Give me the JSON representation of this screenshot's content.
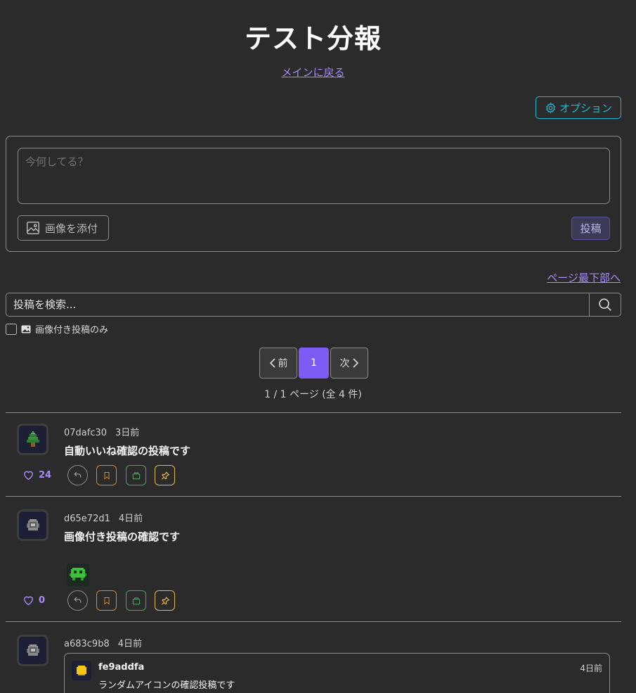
{
  "header": {
    "title": "テスト分報",
    "back_link": "メインに戻る",
    "options_label": "オプション"
  },
  "compose": {
    "placeholder": "今何してる？",
    "attach_label": "画像を添付",
    "post_label": "投稿"
  },
  "nav": {
    "bottom_link": "ページ最下部へ"
  },
  "search": {
    "placeholder": "投稿を検索...",
    "filter_label": "画像付き投稿のみ"
  },
  "pager": {
    "prev": "前",
    "current": "1",
    "next": "次",
    "info": "1 / 1 ページ (全 4 件)"
  },
  "posts": [
    {
      "user": "07dafc30",
      "time": "3日前",
      "text": "自動いいね確認の投稿です",
      "likes": "24",
      "avatar_icon": "tree-icon"
    },
    {
      "user": "d65e72d1",
      "time": "4日前",
      "text": "画像付き投稿の確認です",
      "likes": "0",
      "avatar_icon": "robot-icon",
      "image_icon": "green-monster-icon"
    },
    {
      "user": "a683c9b8",
      "time": "4日前",
      "avatar_icon": "robot-icon",
      "quote": {
        "user": "fe9addfa",
        "time": "4日前",
        "text": "ランダムアイコンの確認投稿です",
        "avatar_icon": "yellow-blob-icon"
      }
    }
  ],
  "colors": {
    "background": "#2b2b2b",
    "accent": "#a78bfa",
    "primary": "#7c5cf5",
    "options": "#22b8cf"
  }
}
